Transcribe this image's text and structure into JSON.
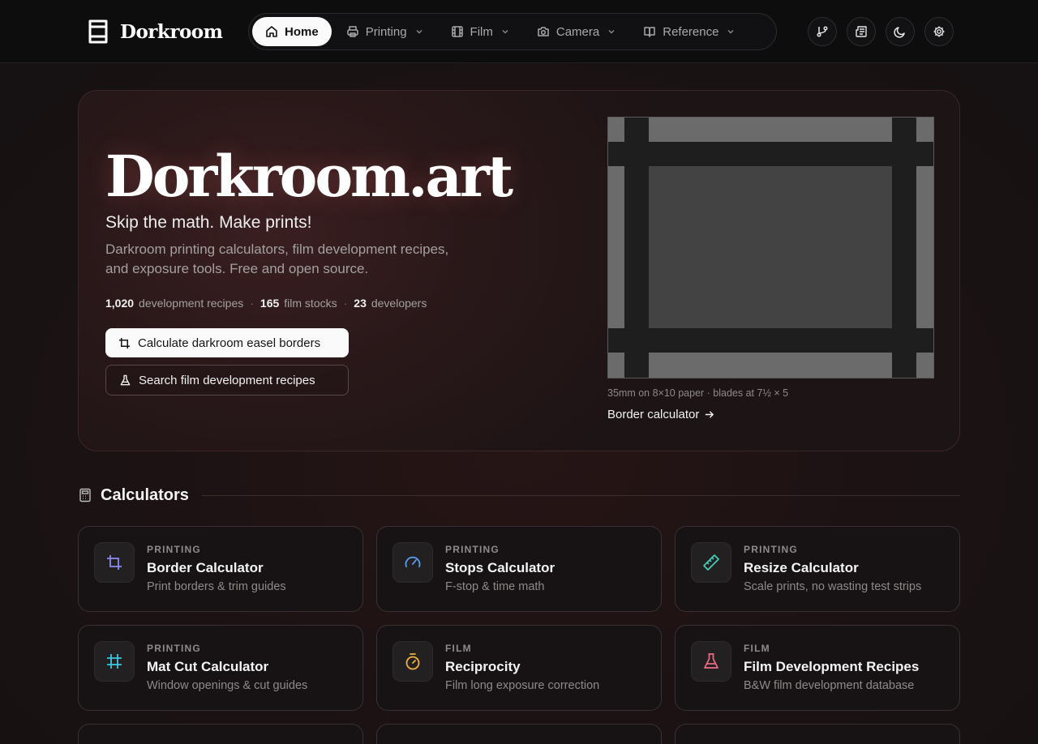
{
  "brand": {
    "name": "Dorkroom"
  },
  "nav": {
    "items": [
      {
        "label": "Home",
        "icon": "home-icon",
        "active": true
      },
      {
        "label": "Printing",
        "icon": "printer-icon"
      },
      {
        "label": "Film",
        "icon": "film-icon"
      },
      {
        "label": "Camera",
        "icon": "camera-icon"
      },
      {
        "label": "Reference",
        "icon": "book-icon"
      }
    ]
  },
  "header_actions": [
    "git-branch-icon",
    "newspaper-icon",
    "moon-icon",
    "gear-icon"
  ],
  "hero": {
    "title": "Dorkroom.art",
    "subtitle": "Skip the math. Make prints!",
    "description": "Darkroom printing calculators, film development recipes, and exposure tools. Free and open source.",
    "stats": [
      {
        "value": "1,020",
        "label": "development recipes"
      },
      {
        "value": "165",
        "label": "film stocks"
      },
      {
        "value": "23",
        "label": "developers"
      }
    ],
    "primary_button": "Calculate darkroom easel borders",
    "secondary_button": "Search film development recipes",
    "preview_caption": "35mm on 8×10 paper · blades at 7½ × 5",
    "preview_link": "Border calculator"
  },
  "section": {
    "title": "Calculators"
  },
  "cards": [
    {
      "category": "PRINTING",
      "title": "Border Calculator",
      "description": "Print borders & trim guides",
      "icon": "crop-icon",
      "color": "#8b8cf0"
    },
    {
      "category": "PRINTING",
      "title": "Stops Calculator",
      "description": "F-stop & time math",
      "icon": "gauge-icon",
      "color": "#5b9ef5"
    },
    {
      "category": "PRINTING",
      "title": "Resize Calculator",
      "description": "Scale prints, no wasting test strips",
      "icon": "ruler-icon",
      "color": "#3fd0b8"
    },
    {
      "category": "PRINTING",
      "title": "Mat Cut Calculator",
      "description": "Window openings & cut guides",
      "icon": "grid-icon",
      "color": "#3ec6e0"
    },
    {
      "category": "FILM",
      "title": "Reciprocity",
      "description": "Film long exposure correction",
      "icon": "timer-icon",
      "color": "#f2b13a"
    },
    {
      "category": "FILM",
      "title": "Film Development Recipes",
      "description": "B&W film development database",
      "icon": "flask-icon",
      "color": "#f06b86"
    }
  ]
}
